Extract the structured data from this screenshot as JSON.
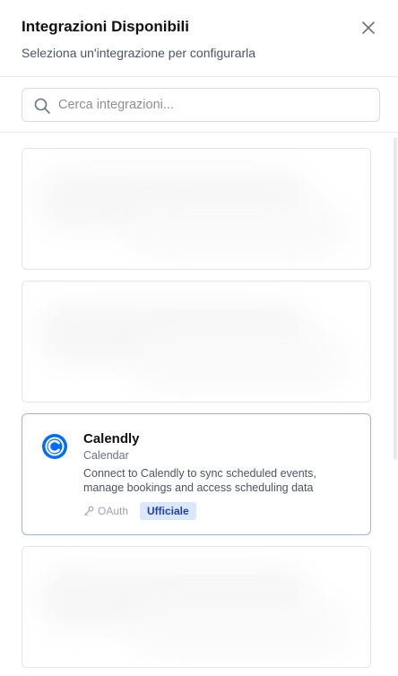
{
  "header": {
    "title": "Integrazioni Disponibili",
    "subtitle": "Seleziona un'integrazione per configurarla"
  },
  "search": {
    "placeholder": "Cerca integrazioni...",
    "value": ""
  },
  "integrations": [
    {
      "state": "loading"
    },
    {
      "state": "loading"
    },
    {
      "state": "loaded",
      "name": "Calendly",
      "category": "Calendar",
      "description": "Connect to Calendly to sync scheduled events, manage bookings and access scheduling data",
      "auth": "OAuth",
      "badge": "Ufficiale",
      "icon": "calendly-logo-icon",
      "selected": true
    },
    {
      "state": "loading"
    }
  ],
  "colors": {
    "badge_bg": "#dbe7fb",
    "badge_text": "#1e40af",
    "calendly_blue": "#006bff",
    "selected_border": "#9db4e8"
  }
}
